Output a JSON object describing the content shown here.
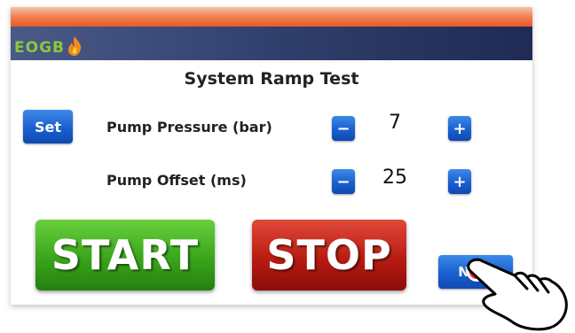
{
  "brand": {
    "logo_text": "EOGB",
    "logo_color": "#8dc63f",
    "logo_icon": "flame-icon"
  },
  "screen": {
    "title": "System Ramp Test"
  },
  "set_button": {
    "label": "Set"
  },
  "rows": [
    {
      "label": "Pump Pressure (bar)",
      "value": "7",
      "minus": "−",
      "plus": "+"
    },
    {
      "label": "Pump Offset (ms)",
      "value": "25",
      "minus": "−",
      "plus": "+"
    }
  ],
  "actions": {
    "start_label": "START",
    "stop_label": "STOP",
    "next_label": "Next"
  },
  "colors": {
    "start": "#3aa51b",
    "stop": "#b81c12",
    "button_blue": "#1a5fd0",
    "header": "#2f3d6a",
    "touch_indicator": "#ff2a3a"
  },
  "overlay": {
    "pointer_icon": "pointing-hand-icon"
  }
}
